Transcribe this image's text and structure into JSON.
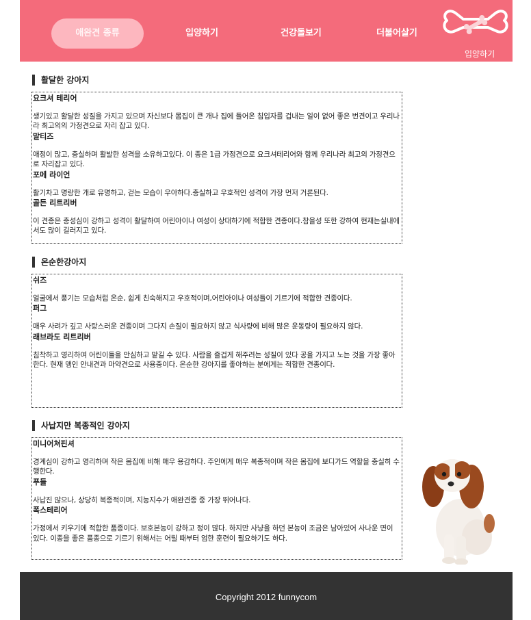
{
  "header": {
    "nav": [
      {
        "label": "애완견 종류",
        "active": true
      },
      {
        "label": "입양하기",
        "active": false
      },
      {
        "label": "건강돌보기",
        "active": false
      },
      {
        "label": "더불어살기",
        "active": false
      }
    ],
    "logo_text": "입양하기",
    "colors": {
      "header_bg": "#f46b7b",
      "active_pill": "#fdb7bf",
      "footer_bg": "#333333"
    }
  },
  "sections": [
    {
      "title": "활달한 강아지",
      "breeds": [
        {
          "name": "요크셔 테리어",
          "desc": "생기있고 활달한 성질을 가지고 있으며 자신보다 몸집이 큰 개나 집에 들어온 침입자를 겁내는 일이 없어 좋은 번견이고 우리나라 최고의의 가정견으로 자리 잡고 있다."
        },
        {
          "name": "말티즈",
          "desc": "애정이 많고, 충실하며 활발한 성격을 소유하고있다. 이 종은 1급 가정견으로 요크셔테리어와 함께 우리나라 최고의 가정견으로 자리잡고 있다."
        },
        {
          "name": "포메 라이언",
          "desc": "활기차고 명랑한 개로 유명하고, 걷는 모습이 우아하다.충실하고 우호적인 성격이 가장 먼저 거론된다."
        },
        {
          "name": "골든 리트리버",
          "desc": "이 견종은 충성심이 강하고 성격이 활달하여 어린아이나 여성이 상대하기에 적합한 견종이다.참을성 또한 강하여 현재는실내에서도 많이 길러지고 있다."
        }
      ]
    },
    {
      "title": "온순한강아지",
      "breeds": [
        {
          "name": "쉬즈",
          "desc": "얼굴에서 풍기는 모습처럼 온순, 쉽게 친숙해지고 우호적이며,어린아이나 여성들이 기르기에 적합한 견종이다."
        },
        {
          "name": "퍼그",
          "desc": "매우 사려가 깊고 사랑스러운 견종이며 그다지 손질이 필요하지 않고 식사량에 비해 많은 운동량이 필요하지 않다."
        },
        {
          "name": "래브라도 리트리버",
          "desc": "침착하고 영리하여 어린이들을 안심하고 맡길 수 있다. 사람을 즐겁게 해주려는 성질이 있다 공을 가지고 노는 것을 가장 좋아한다. 현재 맹인 안내견과 마약견으로 사용중이다. 온순한 강아지를 좋아하는 분에게는 적합한 견종이다."
        }
      ]
    },
    {
      "title": "사납지만 복종적인 강아지",
      "breeds": [
        {
          "name": "미니어쳐핀셔",
          "desc": "경계심이 강하고 영리하며 작은 몸집에 비해 매우 용감하다. 주인에게 매우 복종적이며 작은 몸집에 보디가드 역할을 충실히 수행한다."
        },
        {
          "name": "푸들",
          "desc": "사납진 않으나, 상당히 복종적이며, 지능지수가 애완견종 중 가장 뛰어나다."
        },
        {
          "name": "폭스테리어",
          "desc": "가정에서 키우기에 적합한 품종이다. 보호본능이 강하고 정이 많다. 하지만 사냥을 하던 본능이 조금은 남아있어 사나운 면이 있다. 이종을 좋은 품종으로 기르기 위해서는 어릴 때부터 엄한 훈련이 필요하기도 하다."
        }
      ]
    }
  ],
  "footer": {
    "copyright": "Copyright 2012 funnycom"
  }
}
